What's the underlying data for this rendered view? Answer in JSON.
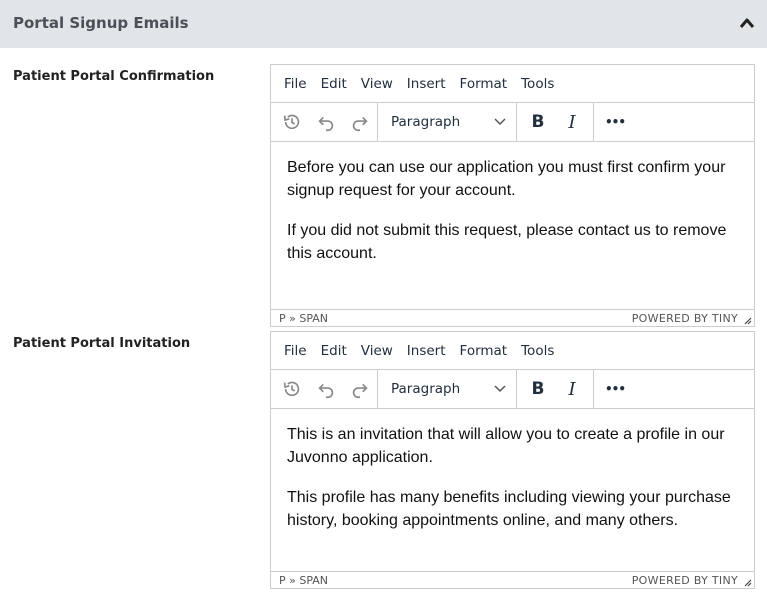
{
  "section": {
    "title": "Portal Signup Emails",
    "icon": "chevron-up-icon"
  },
  "editors": [
    {
      "label": "Patient Portal Confirmation",
      "menu": [
        "File",
        "Edit",
        "View",
        "Insert",
        "Format",
        "Tools"
      ],
      "block_format": "Paragraph",
      "paragraphs": [
        "Before you can use our application you must first confirm your signup request for your account.",
        "If you did not submit this request, please contact us to remove this account."
      ],
      "path": "P » SPAN",
      "branding": "POWERED BY TINY"
    },
    {
      "label": "Patient Portal Invitation",
      "menu": [
        "File",
        "Edit",
        "View",
        "Insert",
        "Format",
        "Tools"
      ],
      "block_format": "Paragraph",
      "paragraphs": [
        "This is an invitation that will allow you to create a profile in our Juvonno application.",
        "This profile has many benefits including viewing your purchase history, booking appointments online, and many others."
      ],
      "path": "P » SPAN",
      "branding": "POWERED BY TINY"
    }
  ],
  "toolbar": {
    "bold": "B",
    "italic": "I",
    "more": "•••"
  }
}
